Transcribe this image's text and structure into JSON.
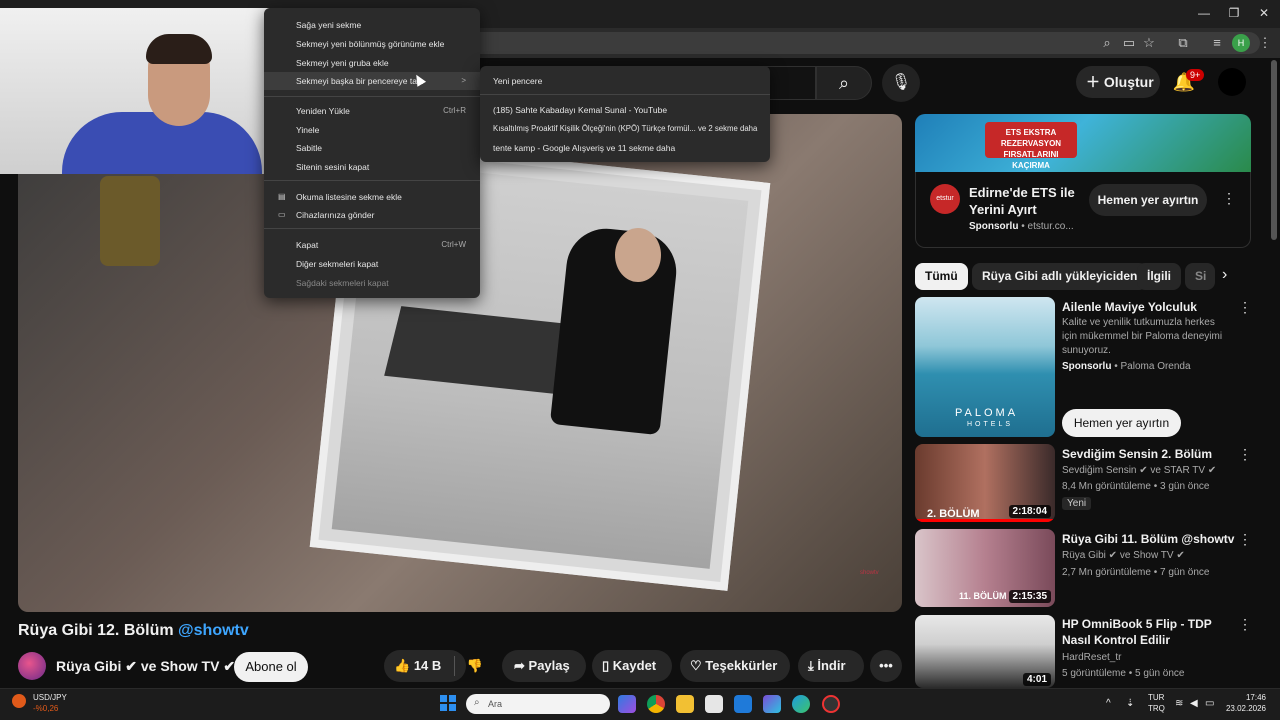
{
  "browser": {
    "context_menu": {
      "items": [
        {
          "label": "Sağa yeni sekme",
          "shortcut": ""
        },
        {
          "label": "Sekmeyi yeni bölünmüş görünüme ekle",
          "shortcut": ""
        },
        {
          "label": "Sekmeyi yeni gruba ekle",
          "shortcut": ""
        },
        {
          "label": "Sekmeyi başka bir pencereye taşı",
          "shortcut": ">"
        },
        {
          "label": "Yeniden Yükle",
          "shortcut": "Ctrl+R"
        },
        {
          "label": "Yinele",
          "shortcut": ""
        },
        {
          "label": "Sabitle",
          "shortcut": ""
        },
        {
          "label": "Sitenin sesini kapat",
          "shortcut": ""
        },
        {
          "label": "Okuma listesine sekme ekle",
          "shortcut": ""
        },
        {
          "label": "Cihazlarınıza gönder",
          "shortcut": ""
        },
        {
          "label": "Kapat",
          "shortcut": "Ctrl+W"
        },
        {
          "label": "Diğer sekmeleri kapat",
          "shortcut": ""
        },
        {
          "label": "Sağdaki sekmeleri kapat",
          "shortcut": ""
        }
      ],
      "submenu": [
        "Yeni pencere",
        "(185) Sahte Kabadayı Kemal Sunal - YouTube",
        "Kısaltılmış Proaktif Kişilik Ölçeği'nin (KPÖ) Türkçe formül... ve 2 sekme daha",
        "tente kamp - Google Alışveriş ve 11 sekme daha"
      ]
    }
  },
  "youtube": {
    "header": {
      "create_label": "Oluştur",
      "notification_badge": "9+"
    },
    "video": {
      "title": "Rüya Gibi 12. Bölüm",
      "title_handle": "@showtv",
      "channel": "Rüya Gibi ✔ ve Show TV ✔",
      "subscribe_label": "Abone ol",
      "likes": "14 B",
      "share_label": "Paylaş",
      "save_label": "Kaydet",
      "thanks_label": "Teşekkürler",
      "download_label": "İndir",
      "watermark": "showtv"
    },
    "ad": {
      "banner_text": "ETS EKSTRA REZERVASYON FIRSATLARINI KAÇIRMA",
      "logo": "etstur",
      "title": "Edirne'de ETS ile Yerini Ayırt",
      "sponsor": "Sponsorlu",
      "domain": "etstur.co...",
      "cta": "Hemen yer ayırtın"
    },
    "chips": [
      "Tümü",
      "Rüya Gibi adlı yükleyiciden",
      "İlgili",
      "Si"
    ],
    "recommendations": [
      {
        "title": "Ailenle Maviye Yolculuk",
        "desc": "Kalite ve yenilik tutkumuzla herkes için mükemmel bir Paloma deneyimi sunuyoruz.",
        "sponsor": "Sponsorlu",
        "advertiser": "Paloma Orenda",
        "cta": "Hemen yer ayırtın",
        "brand": "PALOMA",
        "brand_sub": "HOTELS"
      },
      {
        "title": "Sevdiğim Sensin 2. Bölüm",
        "channel": "Sevdiğim Sensin ✔ ve STAR TV ✔",
        "meta": "8,4 Mn görüntüleme • 3 gün önce",
        "badge": "Yeni",
        "duration": "2:18:04",
        "thumb_text": "2. BÖLÜM"
      },
      {
        "title": "Rüya Gibi 11. Bölüm @showtv",
        "channel": "Rüya Gibi ✔ ve Show TV ✔",
        "meta": "2,7 Mn görüntüleme • 7 gün önce",
        "duration": "2:15:35",
        "thumb_text": "11. BÖLÜM"
      },
      {
        "title": "HP OmniBook 5 Flip - TDP Nasıl Kontrol Edilir",
        "channel": "HardReset_tr",
        "meta": "5 görüntüleme • 5 gün önce",
        "duration": "4:01"
      }
    ]
  },
  "taskbar": {
    "ticker_name": "USD/JPY",
    "ticker_change": "-%0,26",
    "search_placeholder": "Ara",
    "lang_top": "TUR",
    "lang_bottom": "TRQ",
    "time": "17:46",
    "date": "23.02.2026"
  }
}
